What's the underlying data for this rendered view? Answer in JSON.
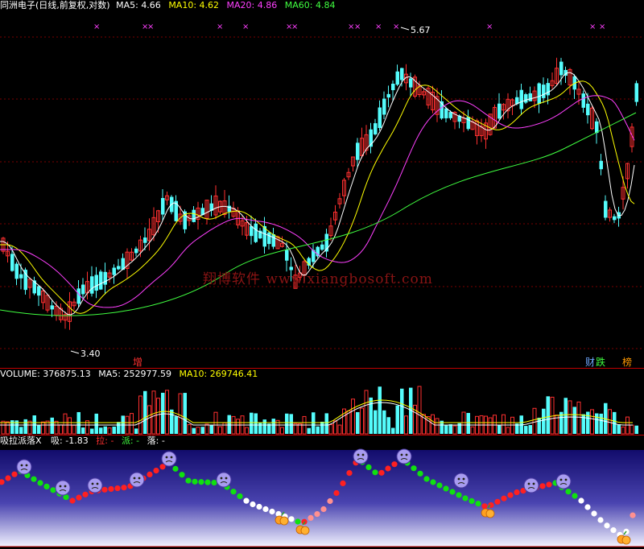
{
  "header": {
    "title": "同洲电子(日线,前复权,对数)",
    "ma5": {
      "label": "MA5:",
      "value": "4.66",
      "color": "#ffffff"
    },
    "ma10": {
      "label": "MA10:",
      "value": "4.62",
      "color": "#ffff00"
    },
    "ma20": {
      "label": "MA20:",
      "value": "4.86",
      "color": "#ff40ff"
    },
    "ma60": {
      "label": "MA60:",
      "value": "4.84",
      "color": "#40ff40"
    }
  },
  "price_chart": {
    "high_label": "5.67",
    "low_label": "3.40",
    "marker_zeng": "增",
    "marker_cai": "财",
    "marker_die": "跌",
    "marker_bang": "榜",
    "top_marker_glyph": "×"
  },
  "volume_panel": {
    "label": "VOLUME:",
    "value": "376875.13",
    "ma5_label": "MA5:",
    "ma5_value": "252977.59",
    "ma10_label": "MA10:",
    "ma10_value": "269746.41"
  },
  "indicator_panel": {
    "title": "吸拉派落X",
    "xi_label": "吸:",
    "xi_value": "-1.83",
    "la_label": "拉:",
    "la_value": "-",
    "pai_label": "派:",
    "pai_value": "-",
    "luo_label": "落:",
    "luo_value": "-"
  },
  "watermark": "翔博软件 www.xiangbosoft.com",
  "colors": {
    "up": "#ff3030",
    "down": "#54fcfc",
    "ma5": "#ffffff",
    "ma10": "#ffff00",
    "ma20": "#ff40ff",
    "ma60": "#40ff40",
    "grid": "#7a0000",
    "indicator_bg_top": "#1a1478",
    "indicator_bg_bottom": "#f0f0ff"
  }
}
